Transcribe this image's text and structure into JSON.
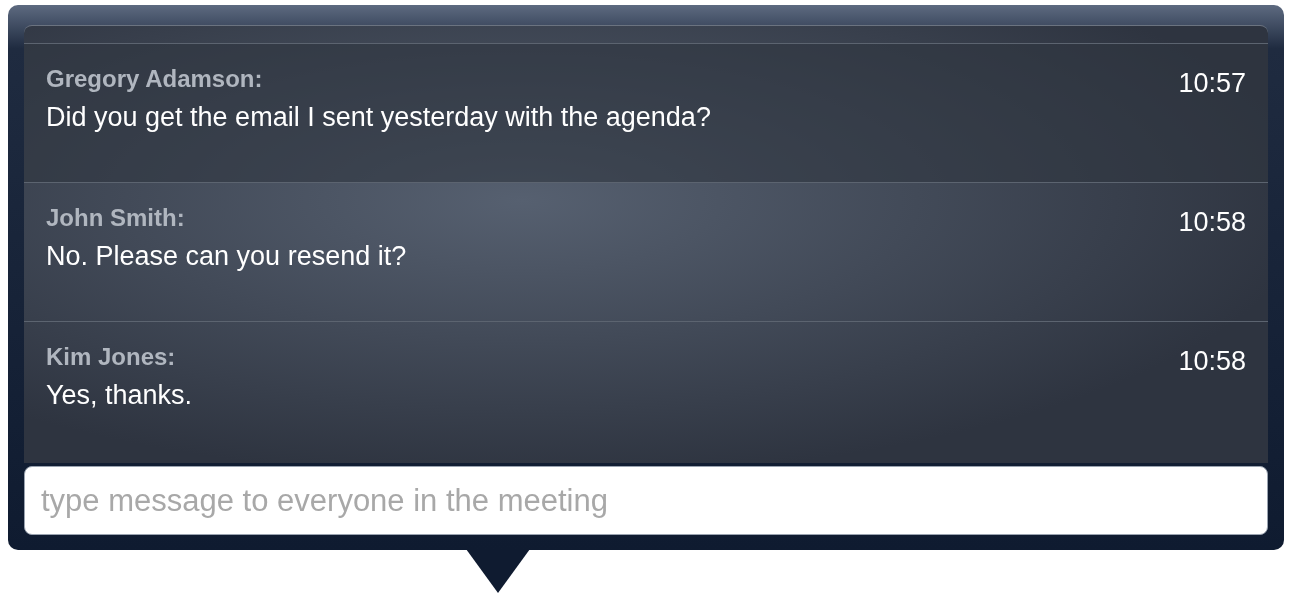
{
  "messages": [
    {
      "sender": "Gregory Adamson:",
      "text": "Did you get the email I sent yesterday with the agenda?",
      "time": "10:57"
    },
    {
      "sender": "John Smith:",
      "text": "No. Please can you resend it?",
      "time": "10:58"
    },
    {
      "sender": "Kim Jones:",
      "text": "Yes, thanks.",
      "time": "10:58"
    }
  ],
  "composer": {
    "placeholder": "type message to everyone in the meeting"
  }
}
